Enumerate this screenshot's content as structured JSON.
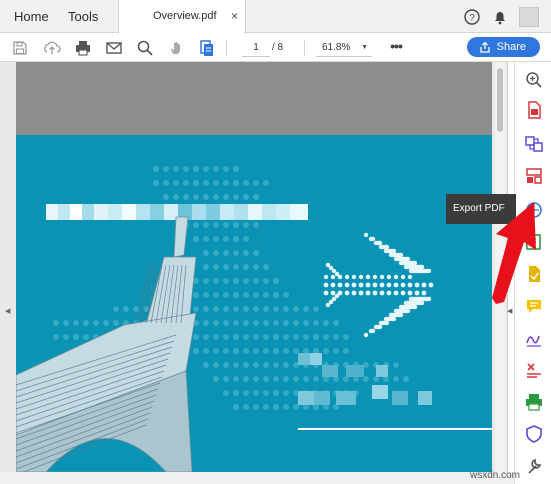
{
  "tabbar": {
    "home_label": "Home",
    "tools_label": "Tools",
    "document_tab_label": "Overview.pdf",
    "close_glyph": "×",
    "icons": [
      "help-icon",
      "bell-icon",
      "avatar"
    ]
  },
  "toolbar": {
    "icons": [
      "save-icon",
      "upload-icon",
      "print-icon",
      "email-icon",
      "search-icon",
      "hand-tool-icon",
      "page-thumbnails-icon"
    ],
    "page_current": "1",
    "page_total": "/ 8",
    "zoom": "61.8%",
    "more_label": "•••",
    "share_label": "Share"
  },
  "tools_pane": {
    "icons": [
      "zoom-icon",
      "create-pdf-icon",
      "combine-files-icon",
      "organize-pages-icon",
      "export-pdf-icon",
      "edit-pdf-icon",
      "fill-sign-icon",
      "comment-icon",
      "sign-icon",
      "redact-icon",
      "print-production-icon",
      "protect-icon",
      "more-tools-icon"
    ]
  },
  "tooltip": {
    "label": "Export PDF"
  },
  "colors": {
    "accent_blue": "#2f76dd",
    "page_teal": "#0a93b4",
    "annotation_red": "#e8111b",
    "tooltip_bg": "#3b3b3b"
  },
  "watermark": "wsxdn.com"
}
